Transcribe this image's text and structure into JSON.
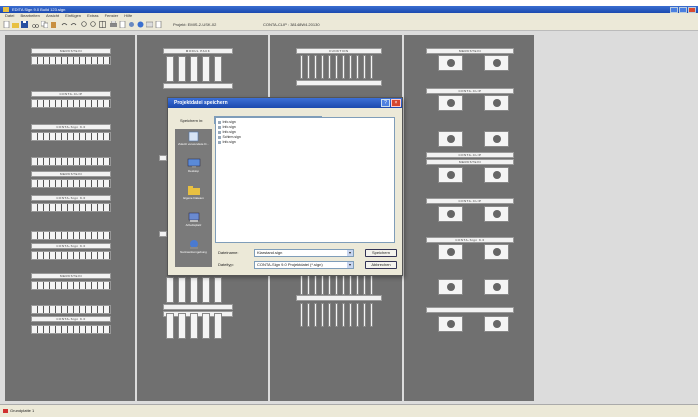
{
  "window": {
    "title": "EDITA Sign 9.0 Build 123.sign",
    "min": "_",
    "max": "□",
    "close": "×"
  },
  "menu": [
    "Datei",
    "Bearbeiten",
    "Ansicht",
    "Einfügen",
    "Extras",
    "Fenster",
    "Hilfe"
  ],
  "toolbar": {
    "project_label": "Projekt: EMIS-2-USK-02",
    "rail_label": "CONTA-CLIP : 38148W4.20130"
  },
  "columns": [
    {
      "title": "MERKSTEIN"
    },
    {
      "title": "MODUL PACK"
    },
    {
      "title": "FUNKTION"
    },
    {
      "title": "MERKSTEIN"
    }
  ],
  "rail_labels": {
    "c1": [
      "CONTA-CLIP",
      "CONTA-Sign 9.0",
      "MERKSTEIN",
      "CONTA-Sign 9.0",
      "CONTA-Sign 9.0",
      "CONTA-Sign 9.0"
    ],
    "c4": [
      "CONTA-CLIP",
      "CONTA-CLIP",
      "MERKSTEIN",
      "CONTA-CLIP",
      "CONTA-Sign 9.0"
    ]
  },
  "dialog": {
    "title": "Projektdatei speichern",
    "help": "?",
    "close": "×",
    "save_in_label": "Speichern in:",
    "save_in_value": "Projekt",
    "places": [
      "Zuletzt verwendete D...",
      "Desktop",
      "Eigene Dateien",
      "Arbeitsplatz",
      "Netzwerkumgebung"
    ],
    "files": [
      "Info.sign",
      "Info.sign",
      "Info.sign",
      "Schirm.sign",
      "Info.sign"
    ],
    "filename_label": "Dateiname:",
    "filename_value": "Klarstand.sign",
    "filetype_label": "Dateityp:",
    "filetype_value": "CONTA-Sign 9.0 Projektdatei (*.sign)",
    "save_button": "Speichern",
    "cancel_button": "Abbrechen"
  },
  "status": {
    "item": "Grundplatte 1"
  }
}
